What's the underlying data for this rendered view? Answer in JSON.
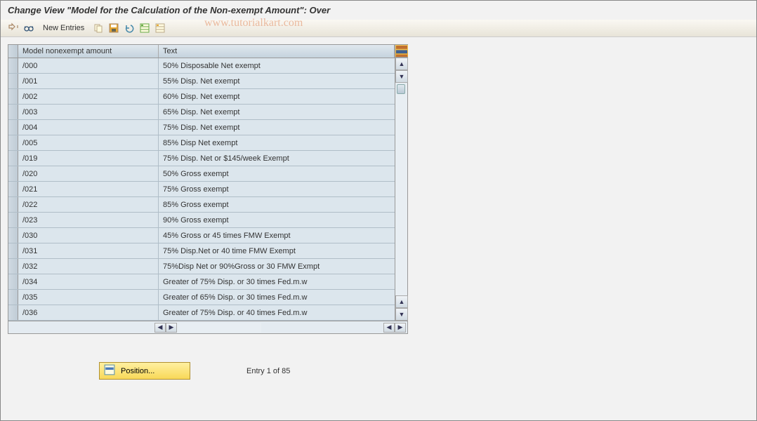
{
  "title": "Change View \"Model for the Calculation of the Non-exempt Amount\": Over",
  "toolbar": {
    "new_entries": "New Entries"
  },
  "watermark": "www.tutorialkart.com",
  "table": {
    "headers": {
      "model": "Model nonexempt amount",
      "text": "Text"
    },
    "rows": [
      {
        "model": "/000",
        "text": "50% Disposable Net exempt"
      },
      {
        "model": "/001",
        "text": "55% Disp. Net exempt"
      },
      {
        "model": "/002",
        "text": "60% Disp. Net exempt"
      },
      {
        "model": "/003",
        "text": "65% Disp. Net exempt"
      },
      {
        "model": "/004",
        "text": "75% Disp. Net exempt"
      },
      {
        "model": "/005",
        "text": "85% Disp Net exempt"
      },
      {
        "model": "/019",
        "text": "75% Disp. Net or $145/week Exempt"
      },
      {
        "model": "/020",
        "text": "50% Gross exempt"
      },
      {
        "model": "/021",
        "text": "75% Gross exempt"
      },
      {
        "model": "/022",
        "text": "85% Gross exempt"
      },
      {
        "model": "/023",
        "text": "90% Gross exempt"
      },
      {
        "model": "/030",
        "text": "45% Gross or 45 times FMW Exempt"
      },
      {
        "model": "/031",
        "text": "75% Disp.Net or 40 time FMW Exempt"
      },
      {
        "model": "/032",
        "text": "75%Disp Net or 90%Gross or 30 FMW  Exmpt"
      },
      {
        "model": "/034",
        "text": "Greater of 75% Disp. or 30 times Fed.m.w"
      },
      {
        "model": "/035",
        "text": "Greater of 65% Disp. or 30 times Fed.m.w"
      },
      {
        "model": "/036",
        "text": "Greater of 75% Disp. or 40 times Fed.m.w"
      }
    ]
  },
  "footer": {
    "position_label": "Position...",
    "entry_status": "Entry 1 of 85"
  }
}
